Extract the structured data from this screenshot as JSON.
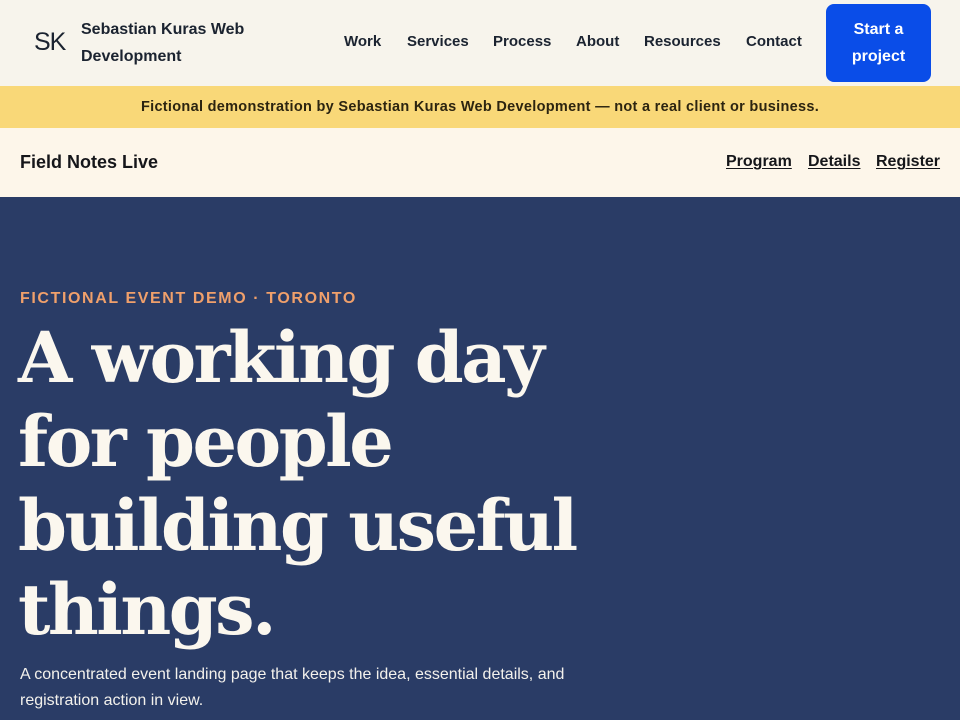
{
  "header": {
    "logo_mark": "SK",
    "brand": "Sebastian Kuras Web Development",
    "nav": [
      "Work",
      "Services",
      "Process",
      "About",
      "Resources",
      "Contact"
    ],
    "cta": "Start a project"
  },
  "notice": "Fictional demonstration by Sebastian Kuras Web Development — not a real client or business.",
  "event_nav": {
    "title": "Field Notes Live",
    "links": [
      "Program",
      "Details",
      "Register"
    ]
  },
  "hero": {
    "eyebrow": "FICTIONAL EVENT DEMO · TORONTO",
    "headline": "A working day for people building useful things.",
    "lede": "A concentrated event landing page that keeps the idea, essential details, and registration action in view."
  },
  "colors": {
    "header_bg": "#f7f4ec",
    "notice_bg": "#f9d878",
    "event_nav_bg": "#fdf6ea",
    "hero_bg": "#2a3c66",
    "accent_orange": "#f0a06b",
    "cta_blue": "#0a4de8"
  }
}
